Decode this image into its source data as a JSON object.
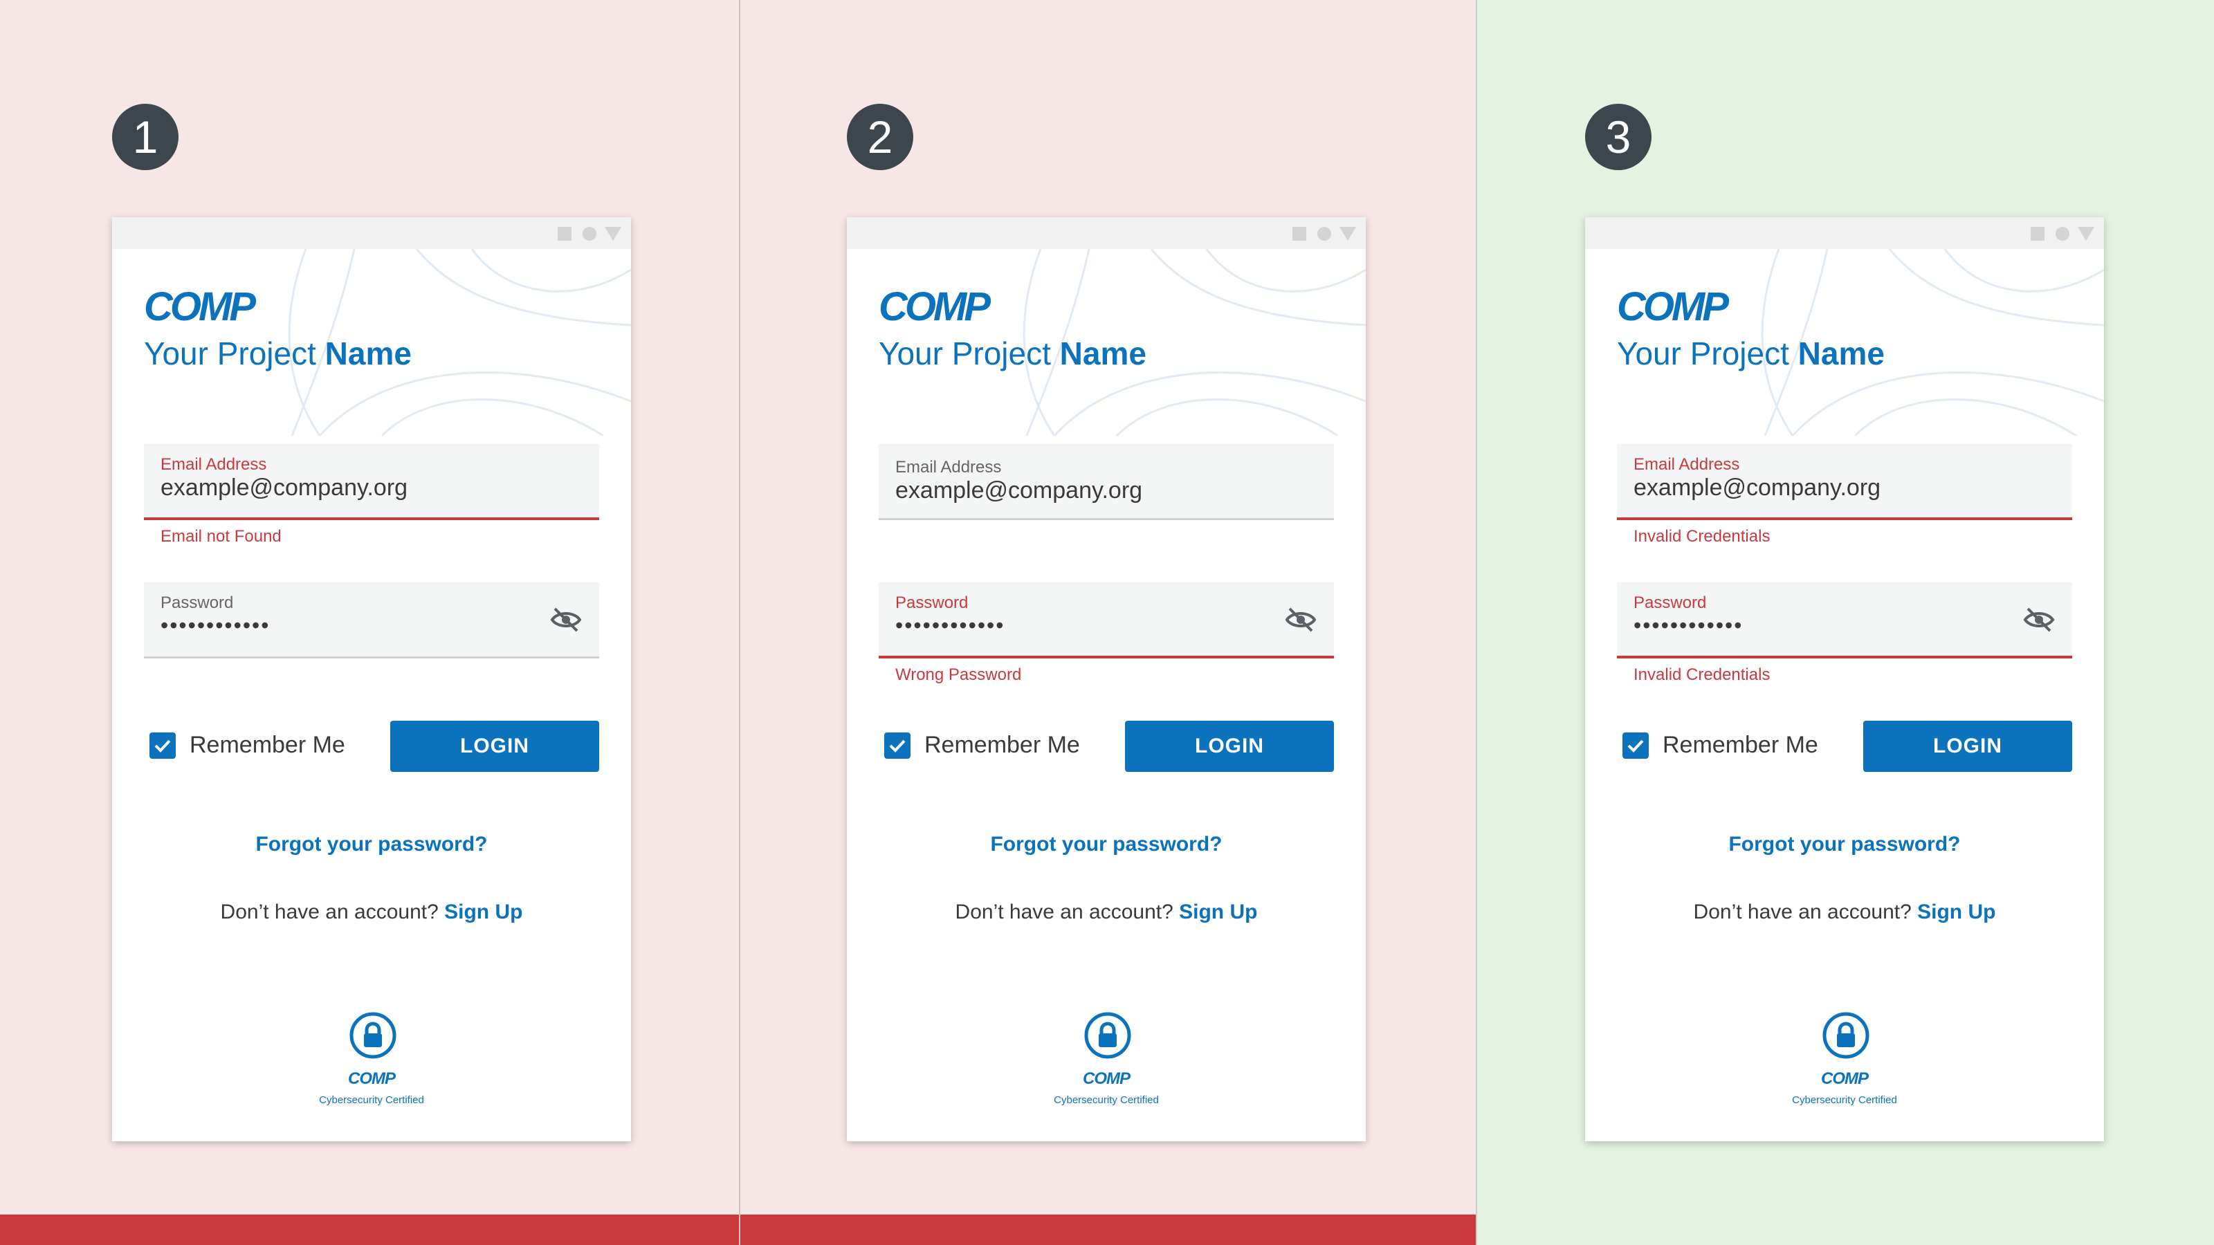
{
  "colors": {
    "brand": "#0b72bd",
    "error": "#c83a3e",
    "error_bg": "#f7e6e6",
    "success_bg": "#e4f2e1",
    "badge": "#3e464d"
  },
  "screens": [
    {
      "step": "1",
      "brand": {
        "logo": "COMP",
        "project_prefix": "Your Project",
        "project_name": "Name"
      },
      "window_controls": [
        "square",
        "circle",
        "triangle"
      ],
      "email": {
        "label": "Email Address",
        "value": "example@company.org",
        "error": "Email not Found"
      },
      "password": {
        "label": "Password",
        "value": "••••••••••••",
        "error": "",
        "toggle_icon": "eye-off-icon"
      },
      "remember_me": {
        "label": "Remember Me",
        "checked": true
      },
      "login_label": "LOGIN",
      "forgot_label": "Forgot your password?",
      "signup_prompt": "Don’t have an account?",
      "signup_label": "Sign Up",
      "footer": {
        "icon": "lock-icon",
        "name": "COMP",
        "caption": "Cybersecurity Certified"
      }
    },
    {
      "step": "2",
      "brand": {
        "logo": "COMP",
        "project_prefix": "Your Project",
        "project_name": "Name"
      },
      "window_controls": [
        "square",
        "circle",
        "triangle"
      ],
      "email": {
        "label": "Email Address",
        "value": "example@company.org",
        "error": ""
      },
      "password": {
        "label": "Password",
        "value": "••••••••••••",
        "error": "Wrong Password",
        "toggle_icon": "eye-off-icon"
      },
      "remember_me": {
        "label": "Remember Me",
        "checked": true
      },
      "login_label": "LOGIN",
      "forgot_label": "Forgot your password?",
      "signup_prompt": "Don’t have an account?",
      "signup_label": "Sign Up",
      "footer": {
        "icon": "lock-icon",
        "name": "COMP",
        "caption": "Cybersecurity Certified"
      }
    },
    {
      "step": "3",
      "brand": {
        "logo": "COMP",
        "project_prefix": "Your Project",
        "project_name": "Name"
      },
      "window_controls": [
        "square",
        "circle",
        "triangle"
      ],
      "email": {
        "label": "Email Address",
        "value": "example@company.org",
        "error": "Invalid Credentials"
      },
      "password": {
        "label": "Password",
        "value": "••••••••••••",
        "error": "Invalid Credentials",
        "toggle_icon": "eye-off-icon"
      },
      "remember_me": {
        "label": "Remember Me",
        "checked": true
      },
      "login_label": "LOGIN",
      "forgot_label": "Forgot your password?",
      "signup_prompt": "Don’t have an account?",
      "signup_label": "Sign Up",
      "footer": {
        "icon": "lock-icon",
        "name": "COMP",
        "caption": "Cybersecurity Certified"
      }
    }
  ]
}
